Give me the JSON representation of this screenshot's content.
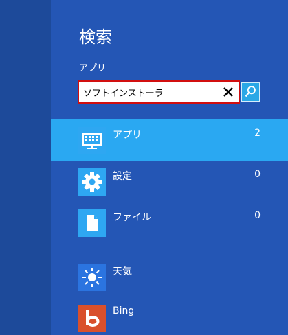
{
  "search": {
    "title": "検索",
    "scope_label": "アプリ",
    "query": "ソフトインストーラ"
  },
  "categories": [
    {
      "label": "アプリ",
      "count": "2",
      "icon": "keyboard-icon",
      "selected": true
    },
    {
      "label": "設定",
      "count": "0",
      "icon": "gear-icon",
      "selected": false
    },
    {
      "label": "ファイル",
      "count": "0",
      "icon": "document-icon",
      "selected": false
    }
  ],
  "apps": [
    {
      "label": "天気",
      "icon": "sun-icon"
    },
    {
      "label": "Bing",
      "icon": "bing-icon"
    }
  ],
  "colors": {
    "pane": "#2456b5",
    "left_strip": "#1d4a9a",
    "selected": "#2aa8f2",
    "highlight_border": "#d20f0f",
    "weather_tile": "#2b74e0",
    "bing_tile": "#d9502c"
  }
}
